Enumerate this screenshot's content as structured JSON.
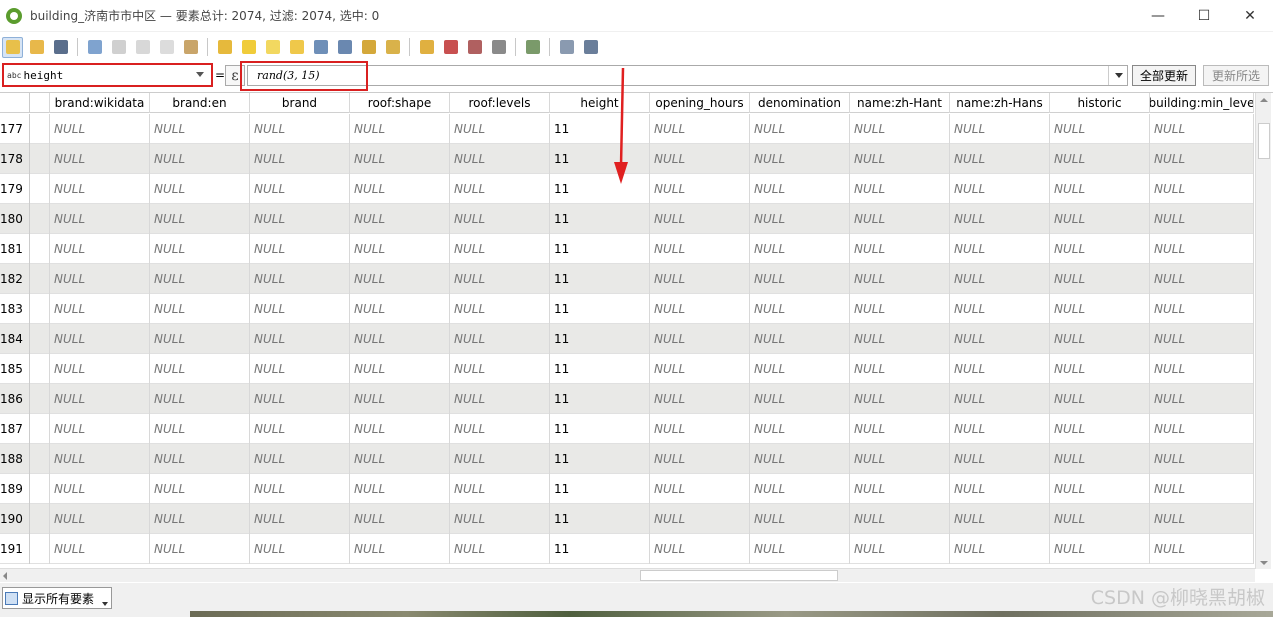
{
  "window": {
    "title": "building_济南市市中区 — 要素总计: 2074, 过滤: 2074, 选中: 0",
    "minimize": "—",
    "maximize": "☐",
    "close": "✕"
  },
  "calc": {
    "field_type": "abc",
    "field": "height",
    "equals": "=",
    "expr_icon": "ε",
    "expression": "rand(3, 15)",
    "update_all": "全部更新",
    "update_selected": "更新所选"
  },
  "table": {
    "columns": [
      "brand:wikidata",
      "brand:en",
      "brand",
      "roof:shape",
      "roof:levels",
      "height",
      "opening_hours",
      "denomination",
      "name:zh-Hant",
      "name:zh-Hans",
      "historic",
      "building:min_leve"
    ],
    "null_text": "NULL",
    "height_value": "11",
    "rows": [
      "177",
      "178",
      "179",
      "180",
      "181",
      "182",
      "183",
      "184",
      "185",
      "186",
      "187",
      "188",
      "189",
      "190",
      "191"
    ]
  },
  "bottom": {
    "filter_label": "显示所有要素",
    "watermark": "CSDN @柳晓黑胡椒"
  },
  "colors": {
    "highlight": "#d92020",
    "alt_row": "#e9e9e7"
  }
}
